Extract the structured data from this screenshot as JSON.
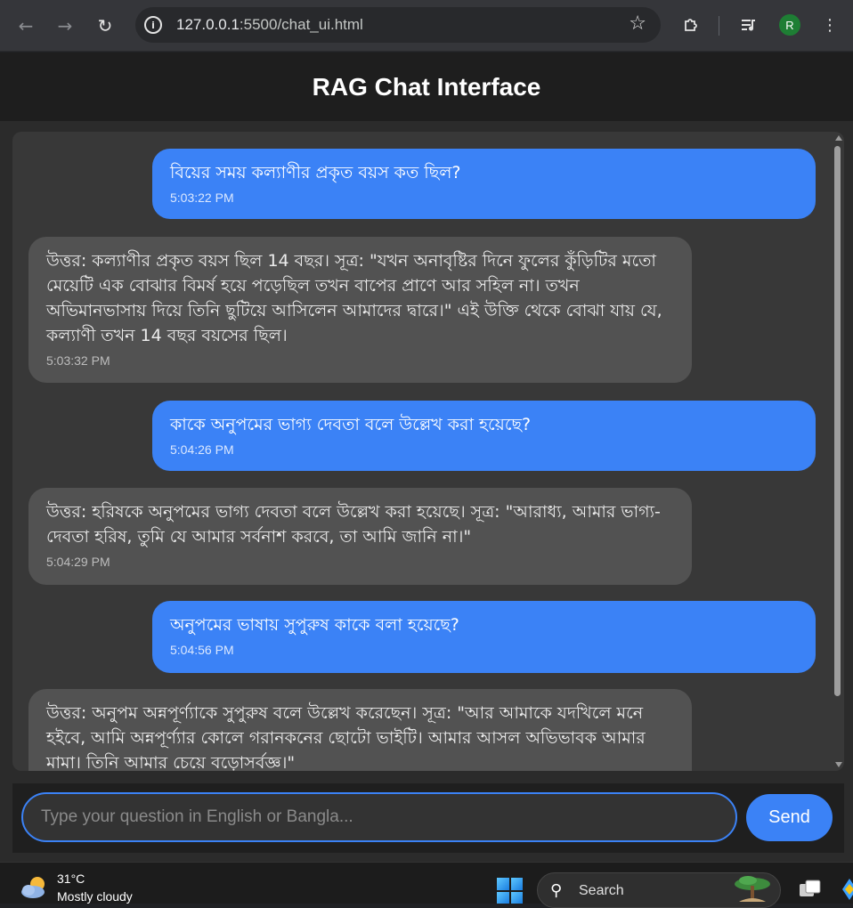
{
  "browser": {
    "url_host": "127.0.0.1",
    "url_path": ":5500/chat_ui.html",
    "profile_initial": "R",
    "icons": [
      "back-icon",
      "forward-icon",
      "reload-icon",
      "site-info-icon",
      "bookmark-star-icon",
      "extensions-icon",
      "media-control-icon",
      "menu-icon"
    ]
  },
  "app": {
    "title": "RAG Chat Interface",
    "colors": {
      "user_bubble": "#3b82f6",
      "bot_bubble": "#525252",
      "header_bg": "#1e1e1e",
      "accent": "#3b82f6"
    }
  },
  "messages": [
    {
      "role": "user",
      "text": "বিয়ের সময় কল্যাণীর প্রকৃত বয়স কত ছিল?",
      "time": "5:03:22 PM"
    },
    {
      "role": "bot",
      "text": "উত্তর: কল্যাণীর প্রকৃত বয়স ছিল 14 বছর। সূত্র: \"যখন অনাবৃষ্টির দিনে ফুলের কুঁড়িটির মতো মেয়েটি এক বোঝার বিমর্ষ হয়ে পড়েছিল তখন বাপের প্রাণে আর সহিল না। তখন অভিমানভাসায় দিয়ে তিনি ছুটিয়ে আসিলেন আমাদের দ্বারে।\" এই উক্তি থেকে বোঝা যায় যে, কল্যাণী তখন 14 বছর বয়সের ছিল।",
      "time": "5:03:32 PM"
    },
    {
      "role": "user",
      "text": "কাকে অনুপমের ভাগ্য দেবতা বলে উল্লেখ করা হয়েছে?",
      "time": "5:04:26 PM"
    },
    {
      "role": "bot",
      "text": "উত্তর: হরিষকে অনুপমের ভাগ্য দেবতা বলে উল্লেখ করা হয়েছে। সূত্র: \"আরাধ্য, আমার ভাগ্য-দেবতা হরিষ, তুমি যে আমার সর্বনাশ করবে, তা আমি জানি না।\"",
      "time": "5:04:29 PM"
    },
    {
      "role": "user",
      "text": "অনুপমের ভাষায় সুপুরুষ কাকে বলা হয়েছে?",
      "time": "5:04:56 PM"
    },
    {
      "role": "bot",
      "text": "উত্তর: অনুপম অন্নপূর্ণ্যাকে সুপুরুষ বলে উল্লেখ করেছেন। সূত্র: \"আর আমাকে যদখিলে মনে হইবে, আমি অন্নপূর্ণ্যার কোলে গরানকনের ছোটো ভাইটি। আমার আসল অভিভাবক আমার মামা। তিনি আমার চেয়ে বড়োসর্বজ্ঞ।\"",
      "time": ""
    }
  ],
  "input": {
    "placeholder": "Type your question in English or Bangla...",
    "value": ""
  },
  "send_label": "Send",
  "taskbar": {
    "temperature": "31°C",
    "weather": "Mostly cloudy",
    "search_label": "Search"
  }
}
